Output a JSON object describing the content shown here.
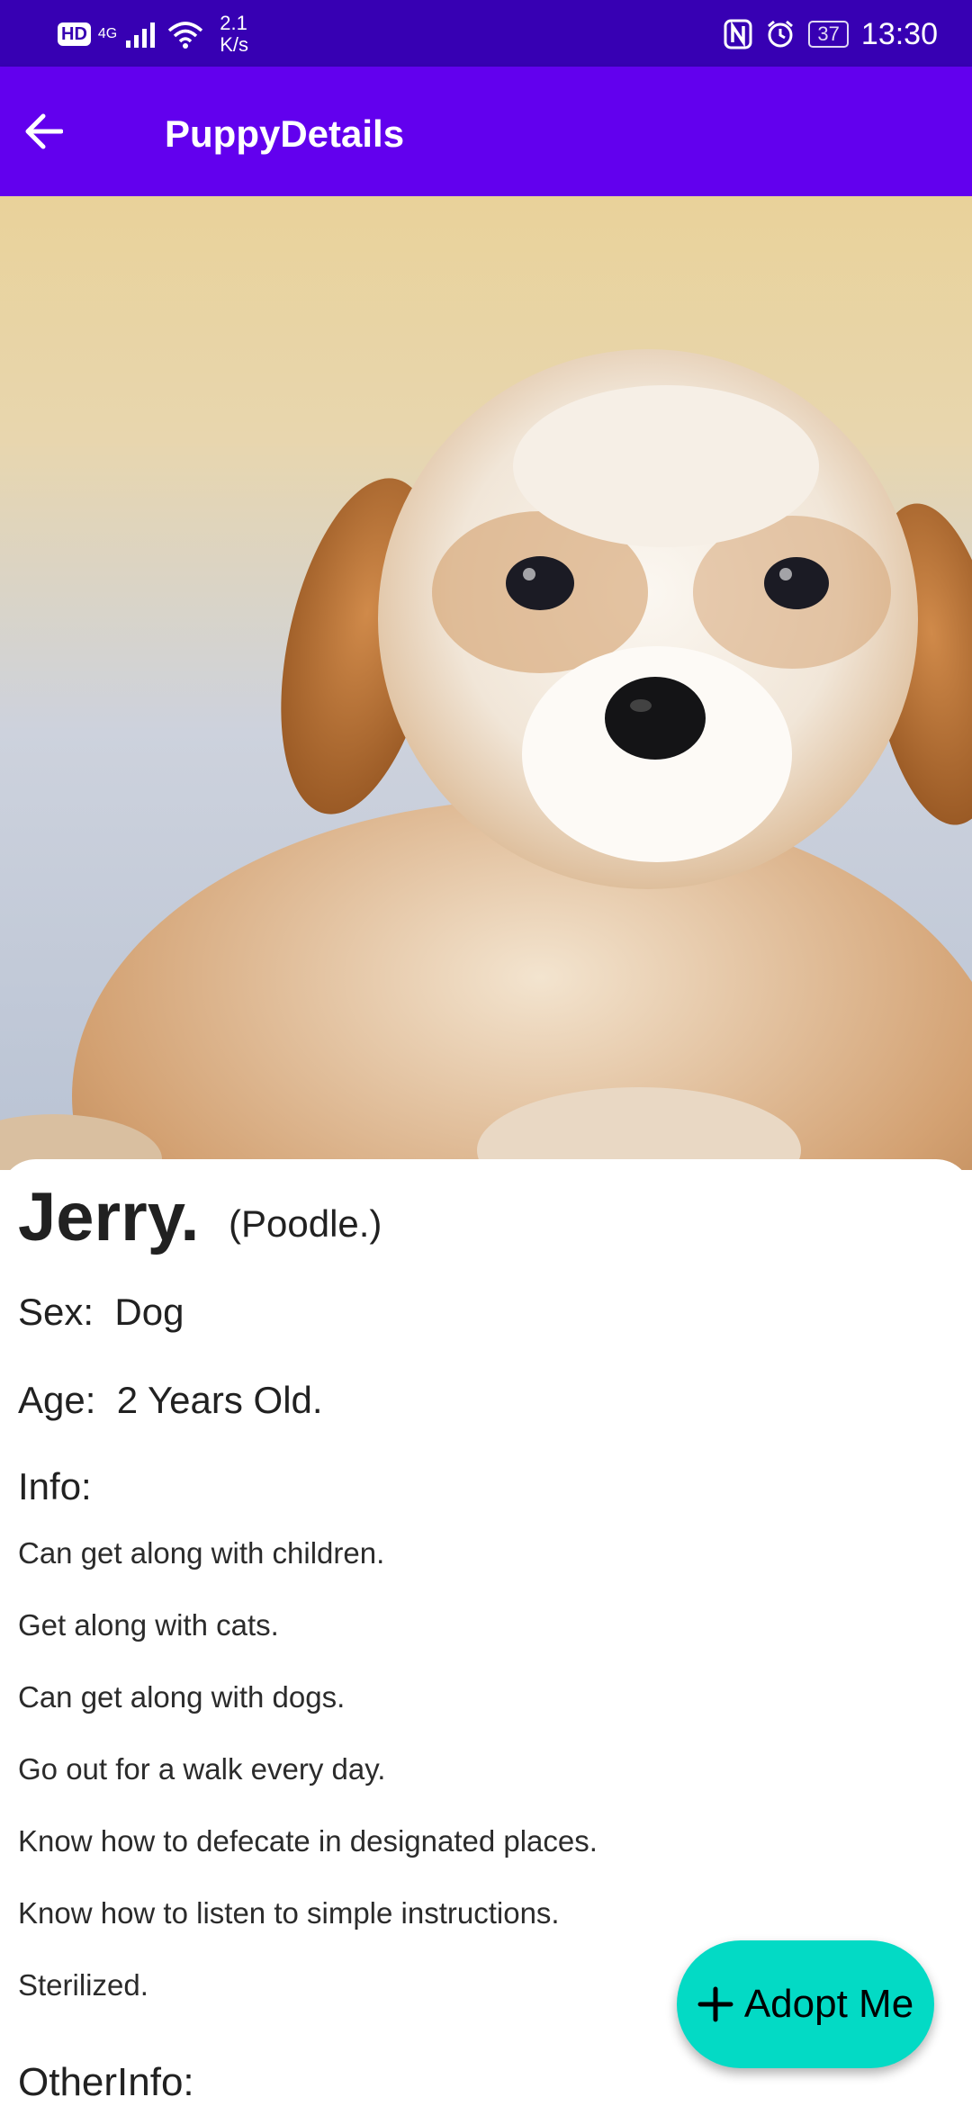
{
  "status_bar": {
    "hd_badge": "HD",
    "network": "4G",
    "speed_value": "2.1",
    "speed_unit": "K/s",
    "battery": "37",
    "time": "13:30"
  },
  "app_bar": {
    "title": "PuppyDetails",
    "back_icon": "arrow-back-icon"
  },
  "puppy": {
    "name": "Jerry.",
    "breed": "(Poodle.)",
    "sex_label": "Sex:",
    "sex_value": "Dog",
    "age_label": "Age:",
    "age_value": "2 Years Old.",
    "info_title": "Info:",
    "info": [
      "Can get along with children.",
      "Get along with cats.",
      "Can get along with dogs.",
      "Go out for a walk every day.",
      "Know how to defecate in designated places.",
      "Know how to listen to simple instructions.",
      "Sterilized."
    ],
    "other_info_title": "OtherInfo:"
  },
  "fab": {
    "icon": "plus-icon",
    "label": "Adopt Me"
  },
  "colors": {
    "status_bar": "#3700b3",
    "app_bar": "#6200ee",
    "fab": "#03dac5"
  }
}
